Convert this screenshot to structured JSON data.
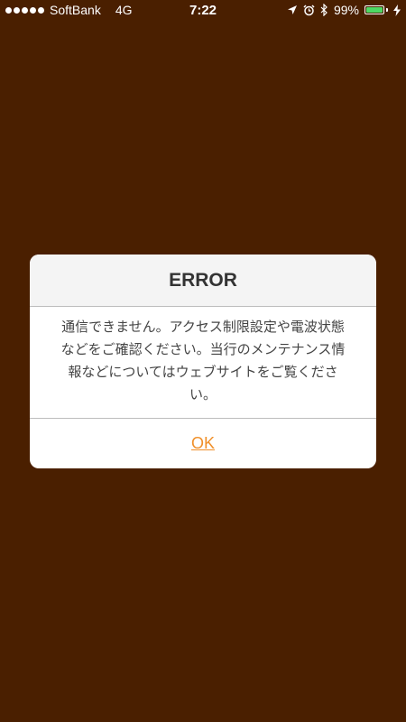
{
  "status_bar": {
    "carrier": "SoftBank",
    "network": "4G",
    "time": "7:22",
    "battery_percent": "99%",
    "battery_level": 0.99,
    "icons": [
      "location-arrow-icon",
      "alarm-clock-icon",
      "bluetooth-icon",
      "battery-icon",
      "charging-bolt-icon"
    ]
  },
  "dialog": {
    "title": "ERROR",
    "message": "通信できません。アクセス制限設定や電波状態などをご確認ください。当行のメンテナンス情報などについてはウェブサイトをご覧ください。",
    "ok_label": "OK"
  },
  "colors": {
    "background": "#4a1f00",
    "accent": "#f0902a",
    "battery": "#4cd964"
  }
}
